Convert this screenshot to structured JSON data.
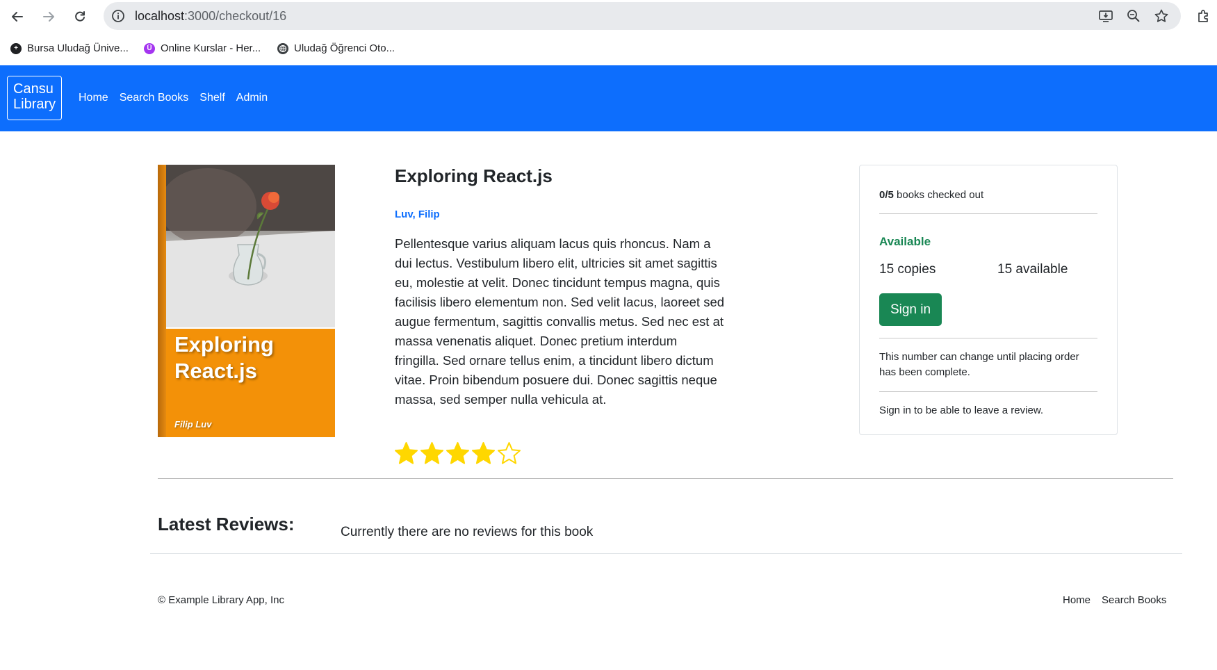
{
  "browser": {
    "url_host": "localhost",
    "url_path": ":3000/checkout/16",
    "bookmarks": [
      {
        "label": "Bursa Uludağ Ünive...",
        "icon": "globe-dark-icon",
        "color": "#202124"
      },
      {
        "label": "Online Kurslar - Her...",
        "icon": "udemy-icon",
        "color": "#a435f0"
      },
      {
        "label": "Uludağ Öğrenci Oto...",
        "icon": "globe-icon",
        "color": "#202124"
      }
    ]
  },
  "navbar": {
    "brand_line1": "Cansu",
    "brand_line2": "Library",
    "links": [
      "Home",
      "Search Books",
      "Shelf",
      "Admin"
    ],
    "color": "#0d6efd"
  },
  "book": {
    "cover_title_line1": "Exploring",
    "cover_title_line2": "React.js",
    "cover_author": "Filip Luv",
    "title": "Exploring React.js",
    "author": "Luv, Filip",
    "description": "Pellentesque varius aliquam lacus quis rhoncus. Nam a dui lectus. Vestibulum libero elit, ultricies sit amet sagittis eu, molestie at velit. Donec tincidunt tempus magna, quis facilisis libero elementum non. Sed velit lacus, laoreet sed augue fermentum, sagittis convallis metus. Sed nec est at massa venenatis aliquet. Donec pretium interdum fringilla. Sed ornare tellus enim, a tincidunt libero dictum vitae. Proin bibendum posuere dui. Donec sagittis neque massa, sed semper nulla vehicula at.",
    "rating": 4,
    "rating_max": 5
  },
  "checkout_card": {
    "checked_out_count": "0/5",
    "checked_out_suffix": " books checked out",
    "status": "Available",
    "copies": "15 copies",
    "available": "15 available",
    "sign_in_label": "Sign in",
    "note": "This number can change until placing order has been complete.",
    "review_prompt": "Sign in to be able to leave a review.",
    "status_color": "#198754"
  },
  "reviews": {
    "title": "Latest Reviews:",
    "empty_message": "Currently there are no reviews for this book"
  },
  "footer": {
    "copyright": "© Example Library App, Inc",
    "links": [
      "Home",
      "Search Books"
    ]
  }
}
